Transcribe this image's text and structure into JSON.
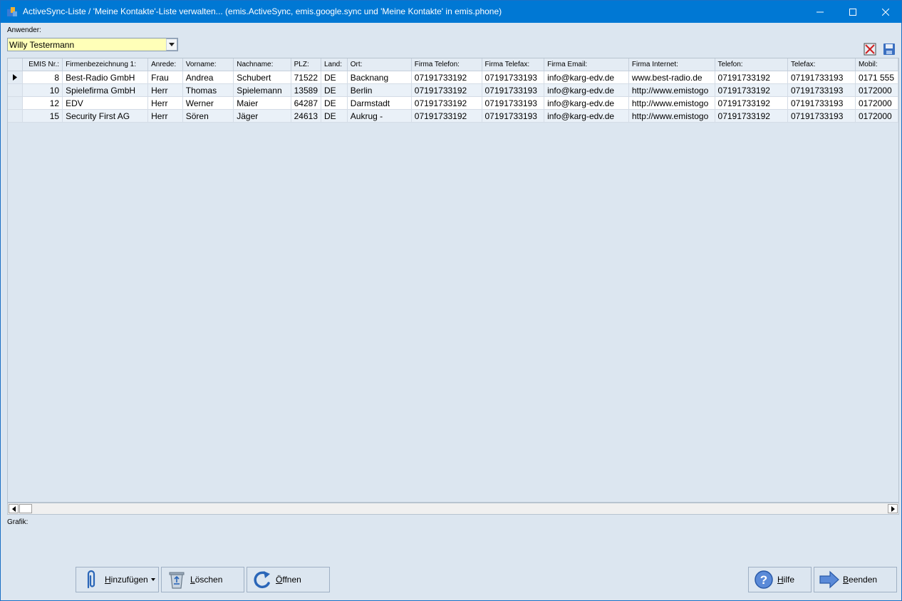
{
  "window": {
    "title": "ActiveSync-Liste / 'Meine Kontakte'-Liste verwalten... (emis.ActiveSync, emis.google.sync und 'Meine Kontakte' in emis.phone)"
  },
  "user": {
    "label": "Anwender:",
    "value": "Willy Testermann"
  },
  "grid": {
    "columns": [
      "EMIS Nr.:",
      "Firmenbezeichnung 1:",
      "Anrede:",
      "Vorname:",
      "Nachname:",
      "PLZ:",
      "Land:",
      "Ort:",
      "Firma Telefon:",
      "Firma Telefax:",
      "Firma Email:",
      "Firma Internet:",
      "Telefon:",
      "Telefax:",
      "Mobil:"
    ],
    "rows": [
      [
        "8",
        "Best-Radio GmbH",
        "Frau",
        "Andrea",
        "Schubert",
        "71522",
        "DE",
        "Backnang",
        "07191733192",
        "07191733193",
        "info@karg-edv.de",
        "www.best-radio.de",
        "07191733192",
        "07191733193",
        "0171 555"
      ],
      [
        "10",
        "Spielefirma GmbH",
        "Herr",
        "Thomas",
        "Spielemann",
        "13589",
        "DE",
        "Berlin",
        "07191733192",
        "07191733193",
        "info@karg-edv.de",
        "http://www.emistogo",
        "07191733192",
        "07191733193",
        "0172000"
      ],
      [
        "12",
        "EDV",
        "Herr",
        "Werner",
        "Maier",
        "64287",
        "DE",
        "Darmstadt",
        "07191733192",
        "07191733193",
        "info@karg-edv.de",
        "http://www.emistogo",
        "07191733192",
        "07191733193",
        "0172000"
      ],
      [
        "15",
        "Security First AG",
        "Herr",
        "Sören",
        "Jäger",
        "24613",
        "DE",
        "Aukrug -",
        "07191733192",
        "07191733193",
        "info@karg-edv.de",
        "http://www.emistogo",
        "07191733192",
        "07191733193",
        "0172000"
      ]
    ]
  },
  "grafik_label": "Grafik:",
  "buttons": {
    "add": {
      "accel": "H",
      "rest": "inzufügen"
    },
    "delete": {
      "accel": "L",
      "rest": "öschen"
    },
    "open": {
      "accel": "Ö",
      "rest": "ffnen"
    },
    "help": {
      "accel": "H",
      "rest": "ilfe"
    },
    "exit": {
      "accel": "B",
      "rest": "eenden"
    }
  }
}
